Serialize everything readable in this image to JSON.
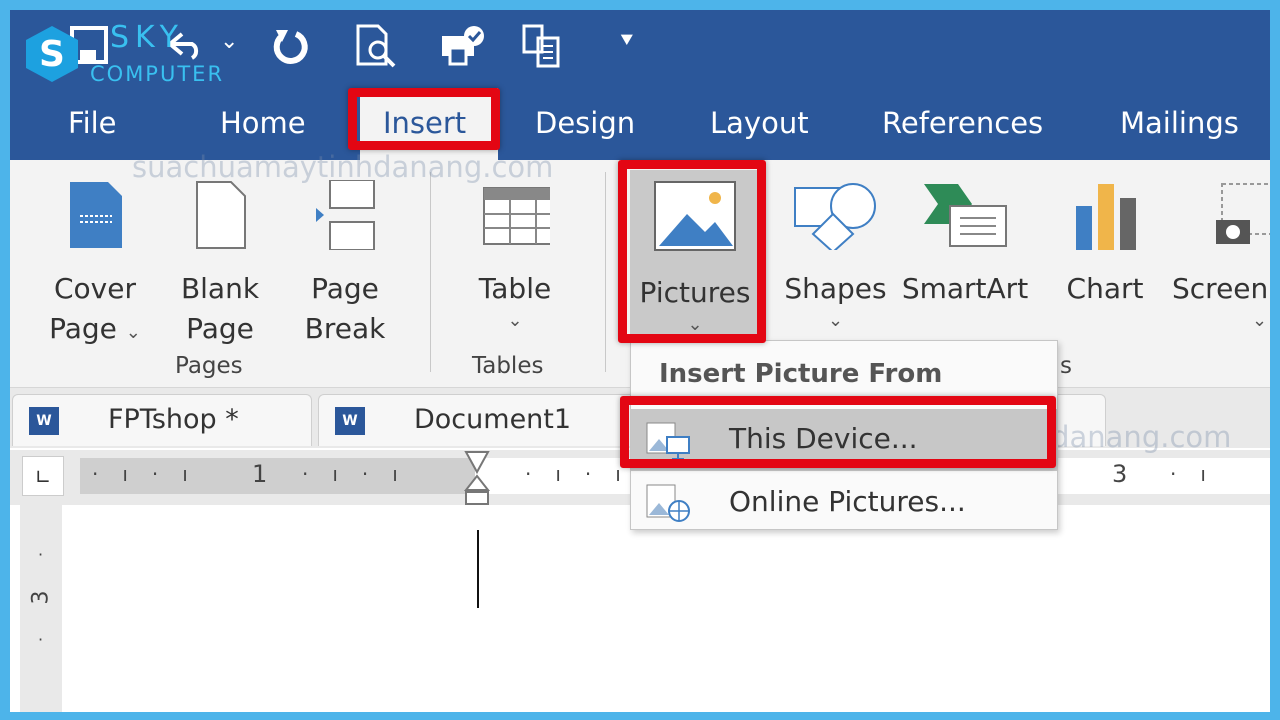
{
  "logo": {
    "line1": "SKY",
    "line2": "COMPUTER"
  },
  "watermark": "suachuamaytinhdanang.com",
  "quick_access": [
    {
      "icon": "save-icon"
    },
    {
      "icon": "undo-icon"
    },
    {
      "icon": "redo-icon"
    },
    {
      "icon": "print-preview-icon"
    },
    {
      "icon": "print-icon"
    },
    {
      "icon": "clipboard-icon"
    },
    {
      "icon": "customize-qat-icon"
    }
  ],
  "tabs": [
    {
      "label": "File"
    },
    {
      "label": "Home"
    },
    {
      "label": "Insert",
      "active": true
    },
    {
      "label": "Design"
    },
    {
      "label": "Layout"
    },
    {
      "label": "References"
    },
    {
      "label": "Mailings"
    }
  ],
  "ribbon": {
    "buttons": [
      {
        "label1": "Cover",
        "label2": "Page",
        "dropdown": true
      },
      {
        "label1": "Blank",
        "label2": "Page"
      },
      {
        "label1": "Page",
        "label2": "Break"
      },
      {
        "label1": "Table",
        "dropdown": true
      },
      {
        "label1": "Pictures",
        "dropdown": true
      },
      {
        "label1": "Shapes",
        "dropdown": true
      },
      {
        "label1": "SmartArt"
      },
      {
        "label1": "Chart"
      },
      {
        "label1": "Screen",
        "dropdown": true
      }
    ],
    "groups": [
      {
        "label": "Pages"
      },
      {
        "label": "Tables"
      },
      {
        "label": "s"
      }
    ]
  },
  "doc_tabs": [
    {
      "label": "FPTshop *"
    },
    {
      "label": "Document1"
    }
  ],
  "ruler": {
    "marks": [
      "1",
      "3"
    ],
    "vertical": "3"
  },
  "menu": {
    "header": "Insert Picture From",
    "items": [
      {
        "label": "This Device...",
        "accel": "D"
      },
      {
        "label": "Online Pictures...",
        "accel": "O"
      }
    ]
  },
  "colors": {
    "title_bar": "#2b579a",
    "highlight": "#e30613",
    "frame": "#4db4ea"
  }
}
